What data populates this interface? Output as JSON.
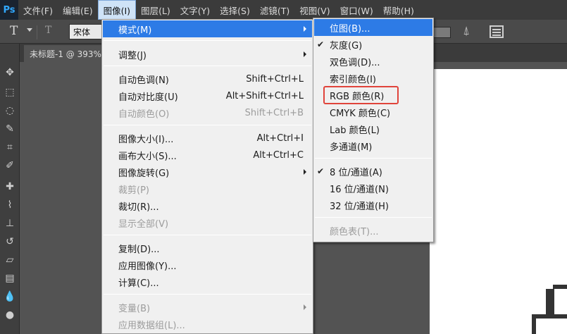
{
  "app": {
    "logo": "Ps"
  },
  "menubar": {
    "items": [
      "文件(F)",
      "编辑(E)",
      "图像(I)",
      "图层(L)",
      "文字(Y)",
      "选择(S)",
      "滤镜(T)",
      "视图(V)",
      "窗口(W)",
      "帮助(H)"
    ],
    "active": "图像(I)"
  },
  "options": {
    "tool_glyph": "T",
    "orientation_glyph": "T",
    "font_family": "宋体"
  },
  "document": {
    "tab_title": "未标题-1 @ 393%"
  },
  "image_menu": {
    "mode": "模式(M)",
    "adjust": "调整(J)",
    "auto_tone": {
      "label": "自动色调(N)",
      "shortcut": "Shift+Ctrl+L"
    },
    "auto_contrast": {
      "label": "自动对比度(U)",
      "shortcut": "Alt+Shift+Ctrl+L"
    },
    "auto_color": {
      "label": "自动颜色(O)",
      "shortcut": "Shift+Ctrl+B"
    },
    "image_size": {
      "label": "图像大小(I)...",
      "shortcut": "Alt+Ctrl+I"
    },
    "canvas_size": {
      "label": "画布大小(S)...",
      "shortcut": "Alt+Ctrl+C"
    },
    "rotate": "图像旋转(G)",
    "crop": "裁剪(P)",
    "trim": "裁切(R)...",
    "reveal_all": "显示全部(V)",
    "duplicate": "复制(D)...",
    "apply_image": "应用图像(Y)...",
    "calculations": "计算(C)...",
    "variables": "变量(B)",
    "apply_data_set": "应用数据组(L)..."
  },
  "mode_submenu": {
    "bitmap": "位图(B)...",
    "grayscale": "灰度(G)",
    "duotone": "双色调(D)...",
    "indexed": "索引颜色(I)",
    "rgb": "RGB 颜色(R)",
    "cmyk": "CMYK 颜色(C)",
    "lab": "Lab 颜色(L)",
    "multichannel": "多通道(M)",
    "bits8": "8 位/通道(A)",
    "bits16": "16 位/通道(N)",
    "bits32": "32 位/通道(H)",
    "color_table": "颜色表(T)...",
    "check_mark": "✔"
  },
  "colors": {
    "highlight": "#2d7be6",
    "annotation_box": "#e0443b"
  }
}
